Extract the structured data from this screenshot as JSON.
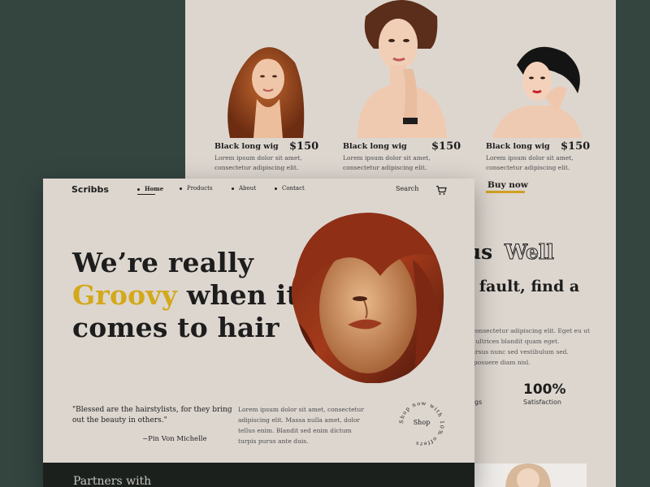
{
  "products": [
    {
      "name": "Black long wig",
      "price": "$150",
      "desc": "Lorem ipsum dolor sit amet, consectetur adipiscing elit."
    },
    {
      "name": "Black long wig",
      "price": "$150",
      "desc": "Lorem ipsum dolor sit amet, consectetur adipiscing elit."
    },
    {
      "name": "Black long wig",
      "price": "$150",
      "desc": "Lorem ipsum dolor sit amet, consectetur adipiscing elit."
    }
  ],
  "buy_now": "Buy now",
  "back_section": {
    "heading_part1": "us",
    "heading_part2": "Well",
    "subheading": "l fault, find a",
    "paragraph_lines": [
      ", consectetur adipiscing elit. Eget eu ut",
      "m ultrices blandit quam eget.",
      "cursus nunc sed vestibulum sed.",
      "e posuere diam nisl."
    ],
    "stats": [
      {
        "number": "",
        "label": "gs"
      },
      {
        "number": "100%",
        "label": "Satisfaction"
      }
    ]
  },
  "nav": {
    "logo": "Scribbs",
    "items": [
      "Home",
      "Products",
      "About",
      "Contact"
    ],
    "search": "Search"
  },
  "hero": {
    "line1": "We’re really",
    "line2_highlight": "Groovy",
    "line2_rest": " when it",
    "line3": "comes to hair"
  },
  "quote": {
    "text": "\"Blessed are the hairstylists, for they bring out the beauty in others.\"",
    "author": "~Pin Von Michelle"
  },
  "lorem": "Lorem ipsum dolor sit amet, consectetur adipiscing elit. Massa nulla amet, dolor tellus enim. Blandit sed enim dictum turpis purus ante duis.",
  "shop_badge": {
    "label": "Shop",
    "ring_text": "Shop now with 10% offers"
  },
  "footer": {
    "partners": "Partners with"
  },
  "colors": {
    "accent": "#d3a81a",
    "background": "#344540",
    "card": "#ddd6cf",
    "dark": "#1d1d1d",
    "footer": "#1b201d"
  }
}
